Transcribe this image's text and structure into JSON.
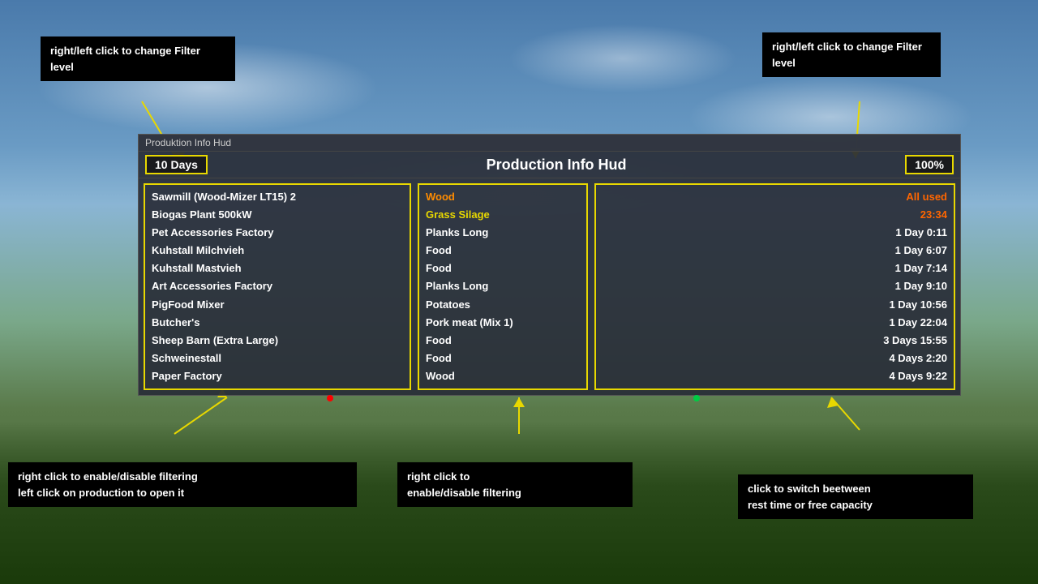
{
  "background": {
    "alt": "Farming Simulator background with sky and trees"
  },
  "hud": {
    "title_bar": "Produktion Info Hud",
    "main_title": "Production Info Hud",
    "filter_days": "10 Days",
    "filter_pct": "100%",
    "productions": [
      "Sawmill (Wood-Mizer LT15) 2",
      "Biogas Plant 500kW",
      "Pet Accessories Factory",
      "Kuhstall Milchvieh",
      "Kuhstall Mastvieh",
      "Art Accessories Factory",
      "PigFood Mixer",
      "Butcher's",
      "Sheep Barn (Extra Large)",
      "Schweinestall",
      "Paper Factory"
    ],
    "outputs": [
      {
        "text": "Wood",
        "color": "orange"
      },
      {
        "text": "Grass Silage",
        "color": "yellow"
      },
      {
        "text": "Planks Long",
        "color": "white"
      },
      {
        "text": "Food",
        "color": "white"
      },
      {
        "text": "Food",
        "color": "white"
      },
      {
        "text": "Planks Long",
        "color": "white"
      },
      {
        "text": "Potatoes",
        "color": "white"
      },
      {
        "text": "Pork meat (Mix 1)",
        "color": "white"
      },
      {
        "text": "Food",
        "color": "white"
      },
      {
        "text": "Food",
        "color": "white"
      },
      {
        "text": "Wood",
        "color": "white"
      }
    ],
    "times": [
      {
        "text": "All used",
        "color": "orange"
      },
      {
        "text": "23:34",
        "color": "orange"
      },
      {
        "text": "1 Day 0:11",
        "color": "white"
      },
      {
        "text": "1 Day 6:07",
        "color": "white"
      },
      {
        "text": "1 Day 7:14",
        "color": "white"
      },
      {
        "text": "1 Day 9:10",
        "color": "white"
      },
      {
        "text": "1 Day 10:56",
        "color": "white"
      },
      {
        "text": "1 Day 22:04",
        "color": "white"
      },
      {
        "text": "3 Days 15:55",
        "color": "white"
      },
      {
        "text": "4 Days 2:20",
        "color": "white"
      },
      {
        "text": "4 Days 9:22",
        "color": "white"
      }
    ]
  },
  "tooltips": {
    "top_left": "right/left click to\nchange Filter level",
    "top_right": "right/left click to\nchange Filter level",
    "bottom_left_line1": "right click to enable/disable filtering",
    "bottom_left_line2": "left click on production to open it",
    "bottom_mid_line1": "right click to",
    "bottom_mid_line2": "enable/disable filtering",
    "bottom_right_line1": "click to switch beetween",
    "bottom_right_line2": "rest time or free capacity"
  }
}
